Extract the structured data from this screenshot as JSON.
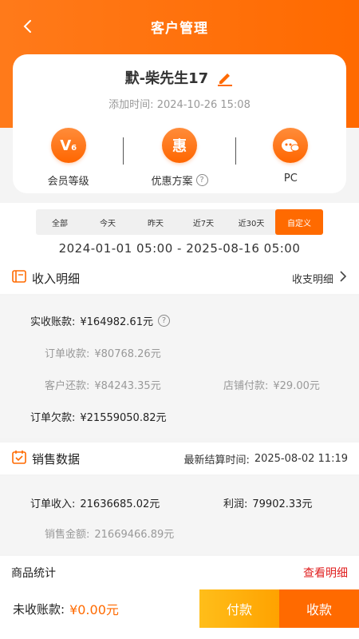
{
  "header": {
    "title": "客户管理"
  },
  "customer": {
    "name": "默-柴先生17",
    "added_label": "添加时间:",
    "added_time": "2024-10-26 15:08"
  },
  "badges": [
    {
      "icon_text": "V6",
      "label": "会员等级",
      "icon": "vip-level-icon"
    },
    {
      "icon_text": "惠",
      "label": "优惠方案",
      "icon": "discount-icon",
      "help": "?"
    },
    {
      "icon_text": "",
      "label": "PC",
      "icon": "pc-avatar-icon"
    }
  ],
  "date_tabs": [
    "全部",
    "今天",
    "昨天",
    "近7天",
    "近30天",
    "自定义"
  ],
  "date_tab_active": "自定义",
  "date_range": "2024-01-01 05:00 - 2025-08-16 05:00",
  "income": {
    "title": "收入明细",
    "link": "收支明细",
    "actual_label": "实收账款:",
    "actual_value": "¥164982.61元",
    "order_receipt_label": "订单收款:",
    "order_receipt_value": "¥80768.26元",
    "repay_label": "客户还款:",
    "repay_value": "¥84243.35元",
    "store_pay_label": "店铺付款:",
    "store_pay_value": "¥29.00元",
    "arrears_label": "订单欠款:",
    "arrears_value": "¥21559050.82元"
  },
  "sales": {
    "title": "销售数据",
    "settle_label": "最新结算时间:",
    "settle_time": "2025-08-02 11:19",
    "order_income_label": "订单收入:",
    "order_income_value": "21636685.02元",
    "profit_label": "利润:",
    "profit_value": "79902.33元",
    "sales_amount_label": "销售金额:",
    "sales_amount_value": "21669466.89元"
  },
  "goods": {
    "title": "商品统计",
    "link": "查看明细"
  },
  "footer": {
    "unpaid_label": "未收账款:",
    "unpaid_value": "¥0.00元",
    "pay_label": "付款",
    "collect_label": "收款"
  },
  "colors": {
    "accent": "#ff6a00",
    "link_red": "#e02020",
    "pay_yellow": "#ffb000"
  }
}
